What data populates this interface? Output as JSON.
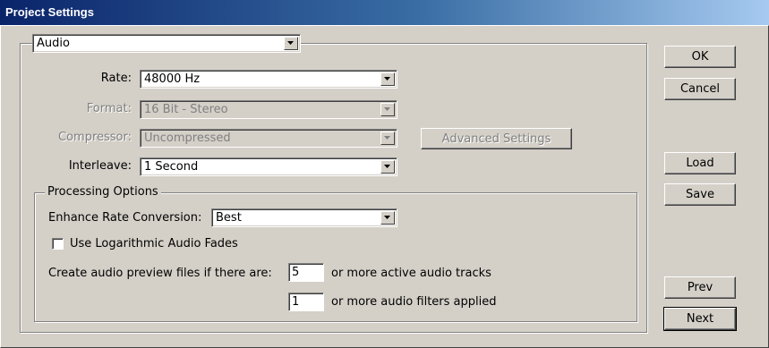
{
  "window": {
    "title": "Project Settings"
  },
  "section_select": {
    "value": "Audio"
  },
  "audio": {
    "rate": {
      "label": "Rate:",
      "value": "48000 Hz"
    },
    "format": {
      "label": "Format:",
      "value": "16 Bit - Stereo"
    },
    "compressor": {
      "label": "Compressor:",
      "value": "Uncompressed"
    },
    "advanced_settings_label": "Advanced Settings",
    "interleave": {
      "label": "Interleave:",
      "value": "1 Second"
    }
  },
  "processing": {
    "legend": "Processing Options",
    "enhance_rate": {
      "label": "Enhance Rate Conversion:",
      "value": "Best"
    },
    "log_fades": {
      "label": "Use Logarithmic Audio Fades",
      "checked": false
    },
    "preview_label": "Create audio preview files if there are:",
    "tracks_value": "5",
    "tracks_suffix": "or more active audio tracks",
    "filters_value": "1",
    "filters_suffix": "or more audio filters applied"
  },
  "buttons": {
    "ok": "OK",
    "cancel": "Cancel",
    "load": "Load",
    "save": "Save",
    "prev": "Prev",
    "next": "Next"
  }
}
